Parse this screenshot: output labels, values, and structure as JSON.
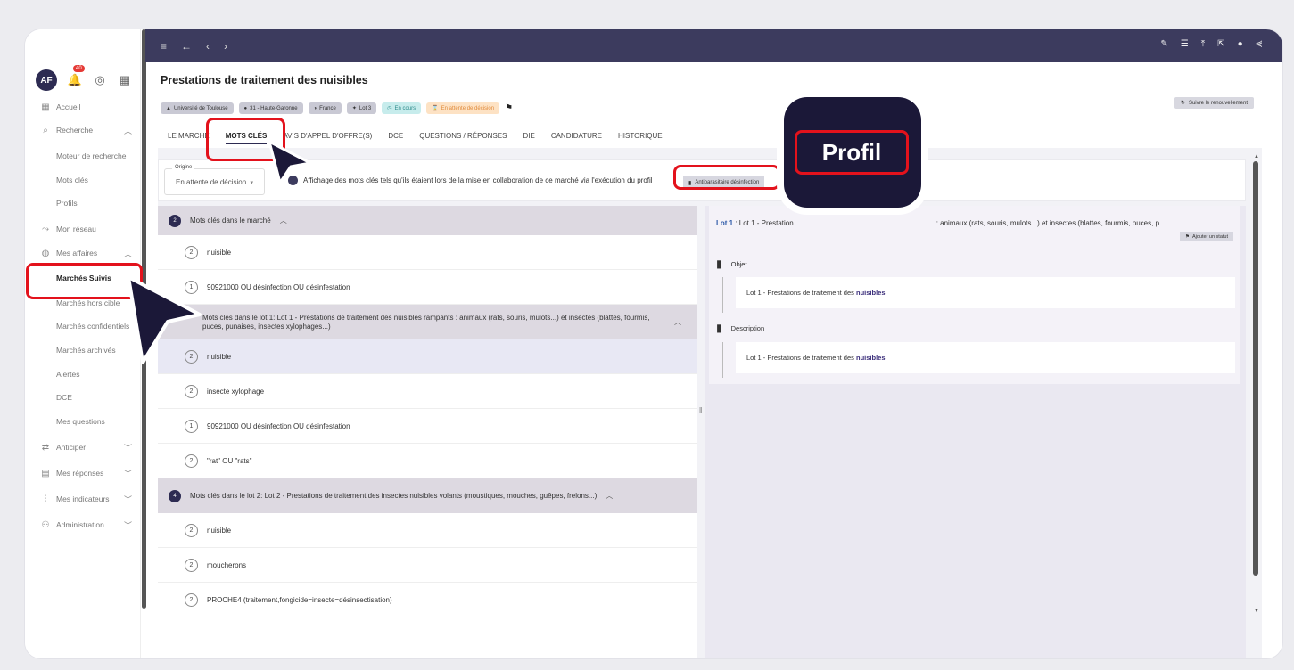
{
  "sidebar": {
    "avatar": "AF",
    "notif_count": "40",
    "items": [
      {
        "label": "Accueil",
        "icon": "grid-icon"
      },
      {
        "label": "Recherche",
        "icon": "search-icon"
      },
      {
        "label": "Moteur de recherche"
      },
      {
        "label": "Mots clés"
      },
      {
        "label": "Profils"
      },
      {
        "label": "Mon réseau",
        "icon": "network-icon"
      },
      {
        "label": "Mes affaires",
        "icon": "briefcase-icon"
      },
      {
        "label": "Marchés Suivis"
      },
      {
        "label": "Marchés hors cible"
      },
      {
        "label": "Marchés confidentiels"
      },
      {
        "label": "Marchés archivés"
      },
      {
        "label": "Alertes"
      },
      {
        "label": "DCE"
      },
      {
        "label": "Mes questions"
      },
      {
        "label": "Anticiper",
        "icon": "refresh-icon"
      },
      {
        "label": "Mes réponses",
        "icon": "document-icon"
      },
      {
        "label": "Mes indicateurs",
        "icon": "chart-icon"
      },
      {
        "label": "Administration",
        "icon": "users-icon"
      }
    ]
  },
  "page": {
    "title": "Prestations de traitement des nuisibles",
    "tags": [
      "Université de Toulouse",
      "31 - Haute-Garonne",
      "France",
      "Lot 3",
      "En cours",
      "En attente de décision"
    ],
    "follow_label": "Suivre le renouvellement",
    "tabs": [
      "LE MARCHÉ",
      "MOTS CLÉS",
      "AVIS D'APPEL D'OFFRE(S)",
      "DCE",
      "QUESTIONS / RÉPONSES",
      "DIE",
      "CANDIDATURE",
      "HISTORIQUE"
    ]
  },
  "origin": {
    "label": "Origine",
    "value": "En attente de décision",
    "info": "Affichage des mots clés tels qu'ils étaient lors de la mise en collaboration de ce marché via l'exécution du profil",
    "profile_tag": "Antiparasitaire désinfection"
  },
  "groups": [
    {
      "count": "2",
      "title": "Mots clés dans le marché",
      "keywords": [
        {
          "n": "2",
          "text": "nuisible"
        },
        {
          "n": "1",
          "text": "90921000 OU désinfection OU désinfestation"
        }
      ]
    },
    {
      "count": "",
      "title": "Mots clés dans le lot 1: Lot 1 - Prestations de traitement des nuisibles rampants : animaux (rats, souris, mulots...) et insectes (blattes, fourmis, puces, punaises, insectes xylophages...)",
      "keywords": [
        {
          "n": "2",
          "text": "nuisible"
        },
        {
          "n": "2",
          "text": "insecte xylophage"
        },
        {
          "n": "1",
          "text": "90921000 OU désinfection OU désinfestation"
        },
        {
          "n": "2",
          "text": "\"rat\" OU \"rats\""
        }
      ]
    },
    {
      "count": "4",
      "title": "Mots clés dans le lot 2: Lot 2 - Prestations de traitement des insectes nuisibles volants (moustiques, mouches, guêpes, frelons...)",
      "keywords": [
        {
          "n": "2",
          "text": "nuisible"
        },
        {
          "n": "2",
          "text": "moucherons"
        },
        {
          "n": "2",
          "text": "PROCHE4 (traitement,fongicide=insecte=désinsectisation)"
        }
      ]
    }
  ],
  "lot_panel": {
    "title_bold": "Lot 1",
    "title_a": " : Lot 1 - Prestation",
    "title_b": ": animaux (rats, souris, mulots...) et insectes (blattes, fourmis, puces, p...",
    "status_label": "Ajouter un statut",
    "sections": [
      {
        "title": "Objet",
        "text": "Lot 1 - Prestations de traitement des ",
        "highlight": "nuisibles"
      },
      {
        "title": "Description",
        "text": "Lot 1 - Prestations de traitement des ",
        "highlight": "nuisibles"
      }
    ]
  },
  "callout": {
    "label": "Profil"
  },
  "colors": {
    "accent": "#2d2b52",
    "highlight": "#e3121c",
    "topbar": "#3c3b5e"
  }
}
